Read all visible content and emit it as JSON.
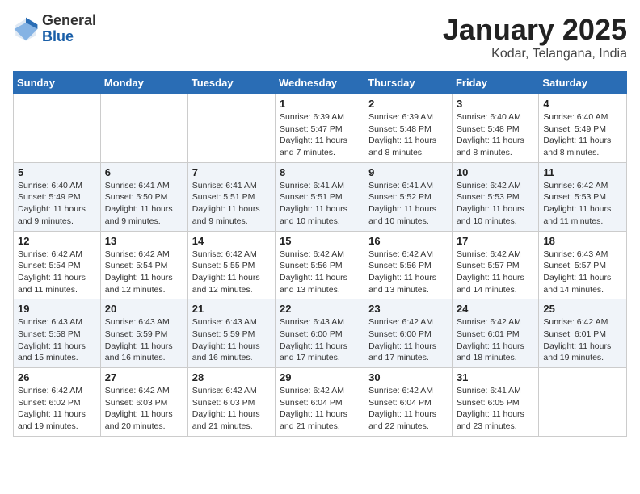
{
  "header": {
    "logo_general": "General",
    "logo_blue": "Blue",
    "month_title": "January 2025",
    "location": "Kodar, Telangana, India"
  },
  "weekdays": [
    "Sunday",
    "Monday",
    "Tuesday",
    "Wednesday",
    "Thursday",
    "Friday",
    "Saturday"
  ],
  "weeks": [
    [
      {
        "day": "",
        "info": ""
      },
      {
        "day": "",
        "info": ""
      },
      {
        "day": "",
        "info": ""
      },
      {
        "day": "1",
        "info": "Sunrise: 6:39 AM\nSunset: 5:47 PM\nDaylight: 11 hours and 7 minutes."
      },
      {
        "day": "2",
        "info": "Sunrise: 6:39 AM\nSunset: 5:48 PM\nDaylight: 11 hours and 8 minutes."
      },
      {
        "day": "3",
        "info": "Sunrise: 6:40 AM\nSunset: 5:48 PM\nDaylight: 11 hours and 8 minutes."
      },
      {
        "day": "4",
        "info": "Sunrise: 6:40 AM\nSunset: 5:49 PM\nDaylight: 11 hours and 8 minutes."
      }
    ],
    [
      {
        "day": "5",
        "info": "Sunrise: 6:40 AM\nSunset: 5:49 PM\nDaylight: 11 hours and 9 minutes."
      },
      {
        "day": "6",
        "info": "Sunrise: 6:41 AM\nSunset: 5:50 PM\nDaylight: 11 hours and 9 minutes."
      },
      {
        "day": "7",
        "info": "Sunrise: 6:41 AM\nSunset: 5:51 PM\nDaylight: 11 hours and 9 minutes."
      },
      {
        "day": "8",
        "info": "Sunrise: 6:41 AM\nSunset: 5:51 PM\nDaylight: 11 hours and 10 minutes."
      },
      {
        "day": "9",
        "info": "Sunrise: 6:41 AM\nSunset: 5:52 PM\nDaylight: 11 hours and 10 minutes."
      },
      {
        "day": "10",
        "info": "Sunrise: 6:42 AM\nSunset: 5:53 PM\nDaylight: 11 hours and 10 minutes."
      },
      {
        "day": "11",
        "info": "Sunrise: 6:42 AM\nSunset: 5:53 PM\nDaylight: 11 hours and 11 minutes."
      }
    ],
    [
      {
        "day": "12",
        "info": "Sunrise: 6:42 AM\nSunset: 5:54 PM\nDaylight: 11 hours and 11 minutes."
      },
      {
        "day": "13",
        "info": "Sunrise: 6:42 AM\nSunset: 5:54 PM\nDaylight: 11 hours and 12 minutes."
      },
      {
        "day": "14",
        "info": "Sunrise: 6:42 AM\nSunset: 5:55 PM\nDaylight: 11 hours and 12 minutes."
      },
      {
        "day": "15",
        "info": "Sunrise: 6:42 AM\nSunset: 5:56 PM\nDaylight: 11 hours and 13 minutes."
      },
      {
        "day": "16",
        "info": "Sunrise: 6:42 AM\nSunset: 5:56 PM\nDaylight: 11 hours and 13 minutes."
      },
      {
        "day": "17",
        "info": "Sunrise: 6:42 AM\nSunset: 5:57 PM\nDaylight: 11 hours and 14 minutes."
      },
      {
        "day": "18",
        "info": "Sunrise: 6:43 AM\nSunset: 5:57 PM\nDaylight: 11 hours and 14 minutes."
      }
    ],
    [
      {
        "day": "19",
        "info": "Sunrise: 6:43 AM\nSunset: 5:58 PM\nDaylight: 11 hours and 15 minutes."
      },
      {
        "day": "20",
        "info": "Sunrise: 6:43 AM\nSunset: 5:59 PM\nDaylight: 11 hours and 16 minutes."
      },
      {
        "day": "21",
        "info": "Sunrise: 6:43 AM\nSunset: 5:59 PM\nDaylight: 11 hours and 16 minutes."
      },
      {
        "day": "22",
        "info": "Sunrise: 6:43 AM\nSunset: 6:00 PM\nDaylight: 11 hours and 17 minutes."
      },
      {
        "day": "23",
        "info": "Sunrise: 6:42 AM\nSunset: 6:00 PM\nDaylight: 11 hours and 17 minutes."
      },
      {
        "day": "24",
        "info": "Sunrise: 6:42 AM\nSunset: 6:01 PM\nDaylight: 11 hours and 18 minutes."
      },
      {
        "day": "25",
        "info": "Sunrise: 6:42 AM\nSunset: 6:01 PM\nDaylight: 11 hours and 19 minutes."
      }
    ],
    [
      {
        "day": "26",
        "info": "Sunrise: 6:42 AM\nSunset: 6:02 PM\nDaylight: 11 hours and 19 minutes."
      },
      {
        "day": "27",
        "info": "Sunrise: 6:42 AM\nSunset: 6:03 PM\nDaylight: 11 hours and 20 minutes."
      },
      {
        "day": "28",
        "info": "Sunrise: 6:42 AM\nSunset: 6:03 PM\nDaylight: 11 hours and 21 minutes."
      },
      {
        "day": "29",
        "info": "Sunrise: 6:42 AM\nSunset: 6:04 PM\nDaylight: 11 hours and 21 minutes."
      },
      {
        "day": "30",
        "info": "Sunrise: 6:42 AM\nSunset: 6:04 PM\nDaylight: 11 hours and 22 minutes."
      },
      {
        "day": "31",
        "info": "Sunrise: 6:41 AM\nSunset: 6:05 PM\nDaylight: 11 hours and 23 minutes."
      },
      {
        "day": "",
        "info": ""
      }
    ]
  ]
}
